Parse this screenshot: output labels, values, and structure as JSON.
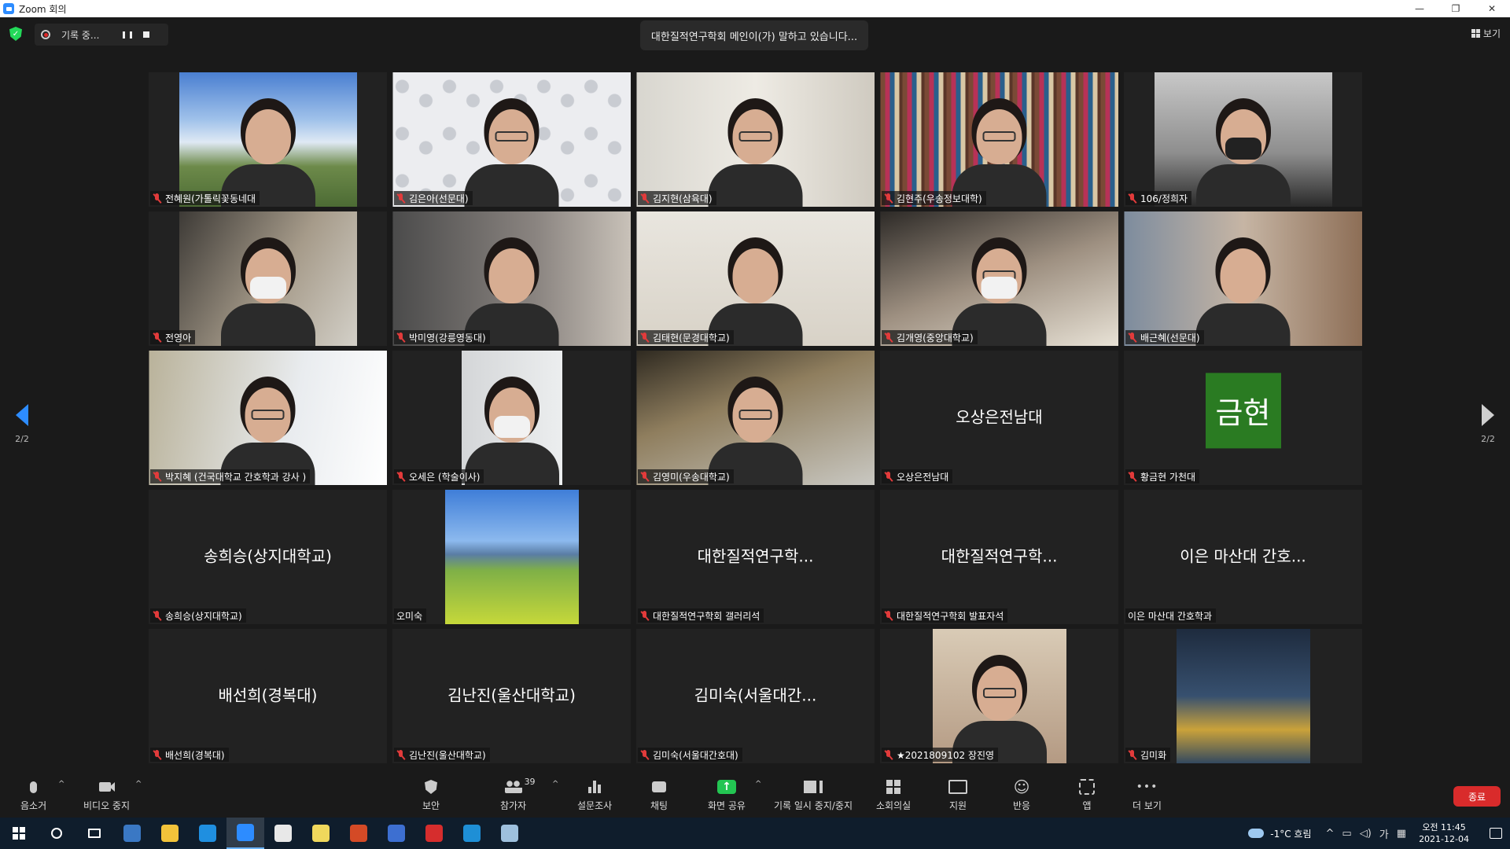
{
  "window": {
    "title": "Zoom 회의",
    "controls": [
      "—",
      "❐",
      "✕"
    ]
  },
  "topbar": {
    "recording_label": "기록 중...",
    "speaker_text": "대한질적연구학회 메인이(가) 말하고 있습니다...",
    "view_label": "보기"
  },
  "pagination": {
    "left_label": "2/2",
    "right_label": "2/2"
  },
  "tiles": [
    {
      "type": "video",
      "bg": "bg-sky",
      "feed": "",
      "person": "",
      "name": "전혜원(가톨릭꽃동네대",
      "muted": true
    },
    {
      "type": "video",
      "bg": "bg-floral",
      "feed": "full",
      "person": "glasses",
      "name": "김은아(선문대)",
      "muted": true
    },
    {
      "type": "video",
      "bg": "bg-wall",
      "feed": "full",
      "person": "glasses",
      "name": "김지현(삼육대)",
      "muted": true
    },
    {
      "type": "video",
      "bg": "bg-books",
      "feed": "full",
      "person": "glasses",
      "name": "김현주(우송정보대학)",
      "muted": true
    },
    {
      "type": "video",
      "bg": "bg-car",
      "feed": "",
      "person": "mask dark",
      "name": "106/정희자",
      "muted": true
    },
    {
      "type": "video",
      "bg": "bg-warm",
      "feed": "",
      "person": "mask",
      "name": "전영아",
      "muted": true
    },
    {
      "type": "video",
      "bg": "bg-grey",
      "feed": "full",
      "person": "",
      "name": "박미영(강릉영동대)",
      "muted": true
    },
    {
      "type": "video",
      "bg": "bg-cream",
      "feed": "full",
      "person": "",
      "name": "김태현(문경대학교)",
      "muted": true
    },
    {
      "type": "video",
      "bg": "bg-office",
      "feed": "full",
      "person": "mask glasses",
      "name": "김개영(중앙대학교)",
      "muted": true
    },
    {
      "type": "video",
      "bg": "bg-room",
      "feed": "full",
      "person": "",
      "name": "배근혜(선문대)",
      "muted": true
    },
    {
      "type": "video",
      "bg": "bg-window",
      "feed": "full",
      "person": "glasses",
      "name": "박지혜 (건국대학교 간호학과 강사 )",
      "muted": true
    },
    {
      "type": "video",
      "bg": "bg-lab",
      "feed": "w128",
      "person": "mask",
      "name": "오세은 (학술이사)",
      "muted": true
    },
    {
      "type": "video",
      "bg": "bg-paint",
      "feed": "full",
      "person": "glasses",
      "name": "김영미(우송대학교)",
      "muted": true
    },
    {
      "type": "text",
      "center": "오상은전남대",
      "name": "오상은전남대",
      "muted": true
    },
    {
      "type": "avatar",
      "avatar": "금현",
      "name": "황금현 가천대",
      "muted": true
    },
    {
      "type": "text",
      "center": "송희승(상지대학교)",
      "name": "송희승(상지대학교)",
      "muted": true
    },
    {
      "type": "video",
      "bg": "bg-mountain",
      "feed": "w170",
      "person": "none",
      "name": "오미숙",
      "muted": false
    },
    {
      "type": "text",
      "center": "대한질적연구학...",
      "name": "대한질적연구학회 갤러리석",
      "muted": true
    },
    {
      "type": "text",
      "center": "대한질적연구학...",
      "name": "대한질적연구학회 발표자석",
      "muted": true
    },
    {
      "type": "text",
      "center": "이은 마산대 간호...",
      "name": "이은 마산대 간호학과",
      "muted": false
    },
    {
      "type": "text",
      "center": "배선희(경복대)",
      "name": "배선희(경복대)",
      "muted": true
    },
    {
      "type": "text",
      "center": "김난진(울산대학교)",
      "name": "김난진(울산대학교)",
      "muted": true
    },
    {
      "type": "text",
      "center": "김미숙(서울대간...",
      "name": "김미숙(서울대간호대)",
      "muted": true
    },
    {
      "type": "video",
      "bg": "bg-photo",
      "feed": "w170",
      "person": "glasses",
      "name": "★2021809102 장진영",
      "muted": true
    },
    {
      "type": "video",
      "bg": "bg-plane",
      "feed": "w170",
      "person": "none",
      "name": "김미화",
      "muted": true
    }
  ],
  "toolbar": {
    "mute": "음소거",
    "stop_video": "비디오 중지",
    "security": "보안",
    "participants": "참가자",
    "participants_count": "39",
    "polls": "설문조사",
    "chat": "채팅",
    "share_screen": "화면 공유",
    "pause_recording": "기록 일시 중지/중지",
    "breakout_rooms": "소회의실",
    "support": "지원",
    "reactions": "반응",
    "apps": "앱",
    "more": "더 보기",
    "end": "종료"
  },
  "taskbar": {
    "weather": "-1°C 흐림",
    "ime": "가",
    "time": "오전 11:45",
    "date": "2021-12-04",
    "colors": [
      "#3a78c4",
      "#f2c33a",
      "#1f8fe0",
      "#2d8cff",
      "#e8e8e8",
      "#f0d85c",
      "#d44a26",
      "#3d6fd1",
      "#d62d2d",
      "#1e8fd6",
      "#9ec0dd"
    ]
  }
}
